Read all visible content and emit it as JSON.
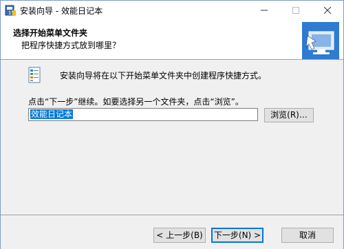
{
  "window": {
    "title": "安装向导 - 效能日记本"
  },
  "header": {
    "title": "选择开始菜单文件夹",
    "subtitle": "把程序快捷方式放到哪里？"
  },
  "main": {
    "description": "安装向导将在以下开始菜单文件夹中创建程序快捷方式。",
    "instruction": "点击“下一步”继续。如要选择另一个文件夹，点击“浏览”。",
    "folder_value": "效能日记本",
    "browse_label": "浏览(R)…"
  },
  "footer": {
    "back_label": "< 上一步(B)",
    "next_label": "下一步(N) >",
    "cancel_label": "取消"
  },
  "colors": {
    "accent": "#0078d7",
    "selection": "#0078d7"
  },
  "icons": {
    "app": "installer-app-icon",
    "wizard": "computer-shortcut-icon",
    "folder": "start-menu-folder-icon"
  }
}
